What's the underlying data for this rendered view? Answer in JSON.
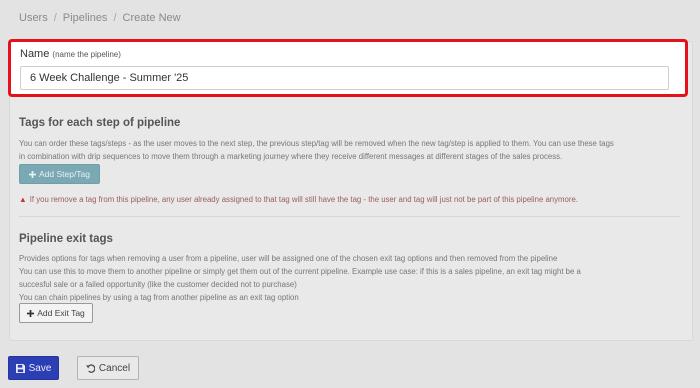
{
  "breadcrumb": {
    "items": [
      "Users",
      "Pipelines",
      "Create New"
    ],
    "separator": "/"
  },
  "name_field": {
    "label": "Name",
    "hint": "(name the pipeline)",
    "value": "6 Week Challenge - Summer '25"
  },
  "tags_section": {
    "title": "Tags for each step of pipeline",
    "description_line1": "You can order these tags/steps - as the user moves to the next step, the previous step/tag will be removed when the new tag/step is applied to them. You can use these tags",
    "description_line2": "in combination with drip sequences to move them through a marketing journey where they receive different messages at different stages of the sales process.",
    "add_button_label": "Add Step/Tag",
    "warning": "If you remove a tag from this pipeline, any user already assigned to that tag will still have the tag - the user and tag will just not be part of this pipeline anymore."
  },
  "exit_section": {
    "title": "Pipeline exit tags",
    "line1": "Provides options for tags when removing a user from a pipeline, user will be assigned one of the chosen exit tag options and then removed from the pipeline",
    "line2": "You can use this to move them to another pipeline or simply get them out of the current pipeline. Example use case: if this is a sales pipeline, an exit tag might be a",
    "line3": "succesful sale or a failed opportunity (like the customer decided not to purchase)",
    "line4": "You can chain pipelines by using a tag from another pipeline as an exit tag option",
    "add_button_label": "Add Exit Tag"
  },
  "footer": {
    "save_label": "Save",
    "cancel_label": "Cancel"
  },
  "icons": {
    "plus": "plus-icon",
    "warning": "warning-icon",
    "save": "floppy-disk-icon",
    "cancel": "undo-icon"
  },
  "colors": {
    "highlight_border": "#e4101a",
    "save_button": "#2b3eb3",
    "add_step_button": "#7aa9b4",
    "warning_text": "#9b5d5d"
  }
}
